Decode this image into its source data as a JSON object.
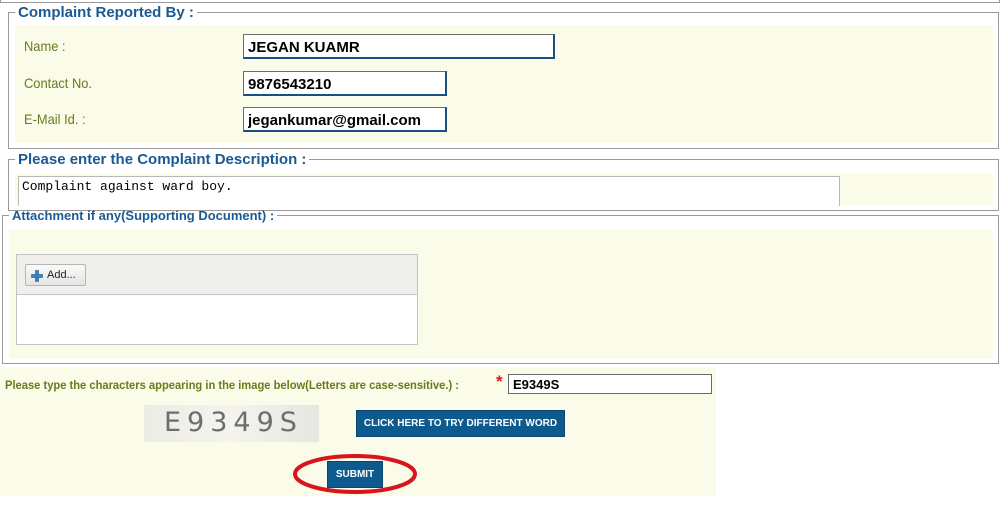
{
  "reported_by": {
    "legend": "Complaint Reported By :",
    "name_label": "Name :",
    "name_value": "JEGAN KUAMR",
    "contact_label": "Contact No.",
    "contact_value": "9876543210",
    "email_label": "E-Mail Id. :",
    "email_value": "jegankumar@gmail.com"
  },
  "description": {
    "legend": "Please enter the Complaint Description :",
    "value": "Complaint against ward boy."
  },
  "attachment": {
    "legend": "Attachment if any(Supporting Document) :",
    "add_label": "Add..."
  },
  "captcha": {
    "prompt": "Please type the characters appearing in the image below(Letters are case-sensitive.) :",
    "required_mark": "*",
    "input_value": "E9349S",
    "image_text": "E9349S",
    "refresh_label": "CLICK HERE TO TRY DIFFERENT WORD"
  },
  "submit_label": "SUBMIT",
  "colors": {
    "panel_bg": "#fbfbea",
    "legend_text": "#1a5a92",
    "label_text": "#6b7a1a",
    "button_bg": "#0d5a8f",
    "highlight_ring": "#d8141c"
  }
}
